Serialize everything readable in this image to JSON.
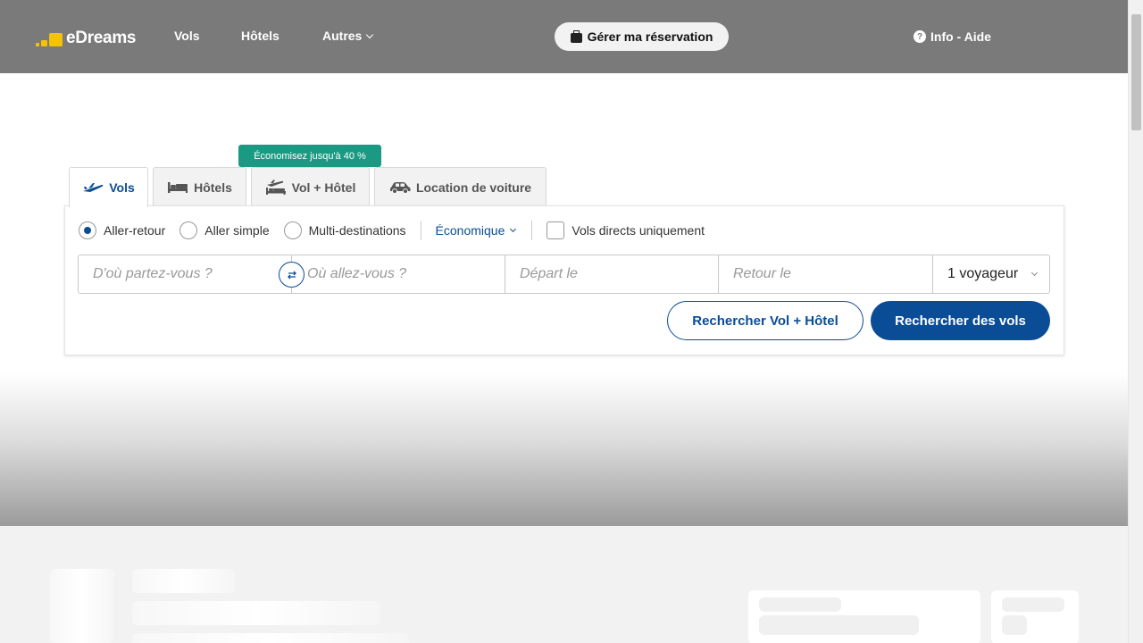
{
  "header": {
    "logo_text": "eDreams",
    "nav": {
      "vols": "Vols",
      "hotels": "Hôtels",
      "autres": "Autres"
    },
    "manage_booking": "Gérer ma réservation",
    "help": "Info - Aide"
  },
  "promo_tooltip": "Économisez jusqu'à 40 %",
  "tabs": [
    {
      "label": "Vols",
      "active": true
    },
    {
      "label": "Hôtels",
      "active": false
    },
    {
      "label": "Vol + Hôtel",
      "active": false
    },
    {
      "label": "Location de voiture",
      "active": false
    }
  ],
  "trip_type": {
    "options": [
      "Aller-retour",
      "Aller simple",
      "Multi-destinations"
    ],
    "selected": "Aller-retour"
  },
  "cabin_class": "Économique",
  "direct_only_label": "Vols directs uniquement",
  "fields": {
    "from_placeholder": "D'où partez-vous ?",
    "to_placeholder": "Où allez-vous ?",
    "departure_placeholder": "Départ le",
    "return_placeholder": "Retour le",
    "travellers": "1 voyageur"
  },
  "buttons": {
    "search_flight_hotel": "Rechercher Vol + Hôtel",
    "search_flights": "Rechercher des vols"
  },
  "colors": {
    "header_bg": "#7a7a7a",
    "primary": "#0a4c96",
    "promo": "#1a9a83",
    "logo_yellow": "#f5c400"
  }
}
